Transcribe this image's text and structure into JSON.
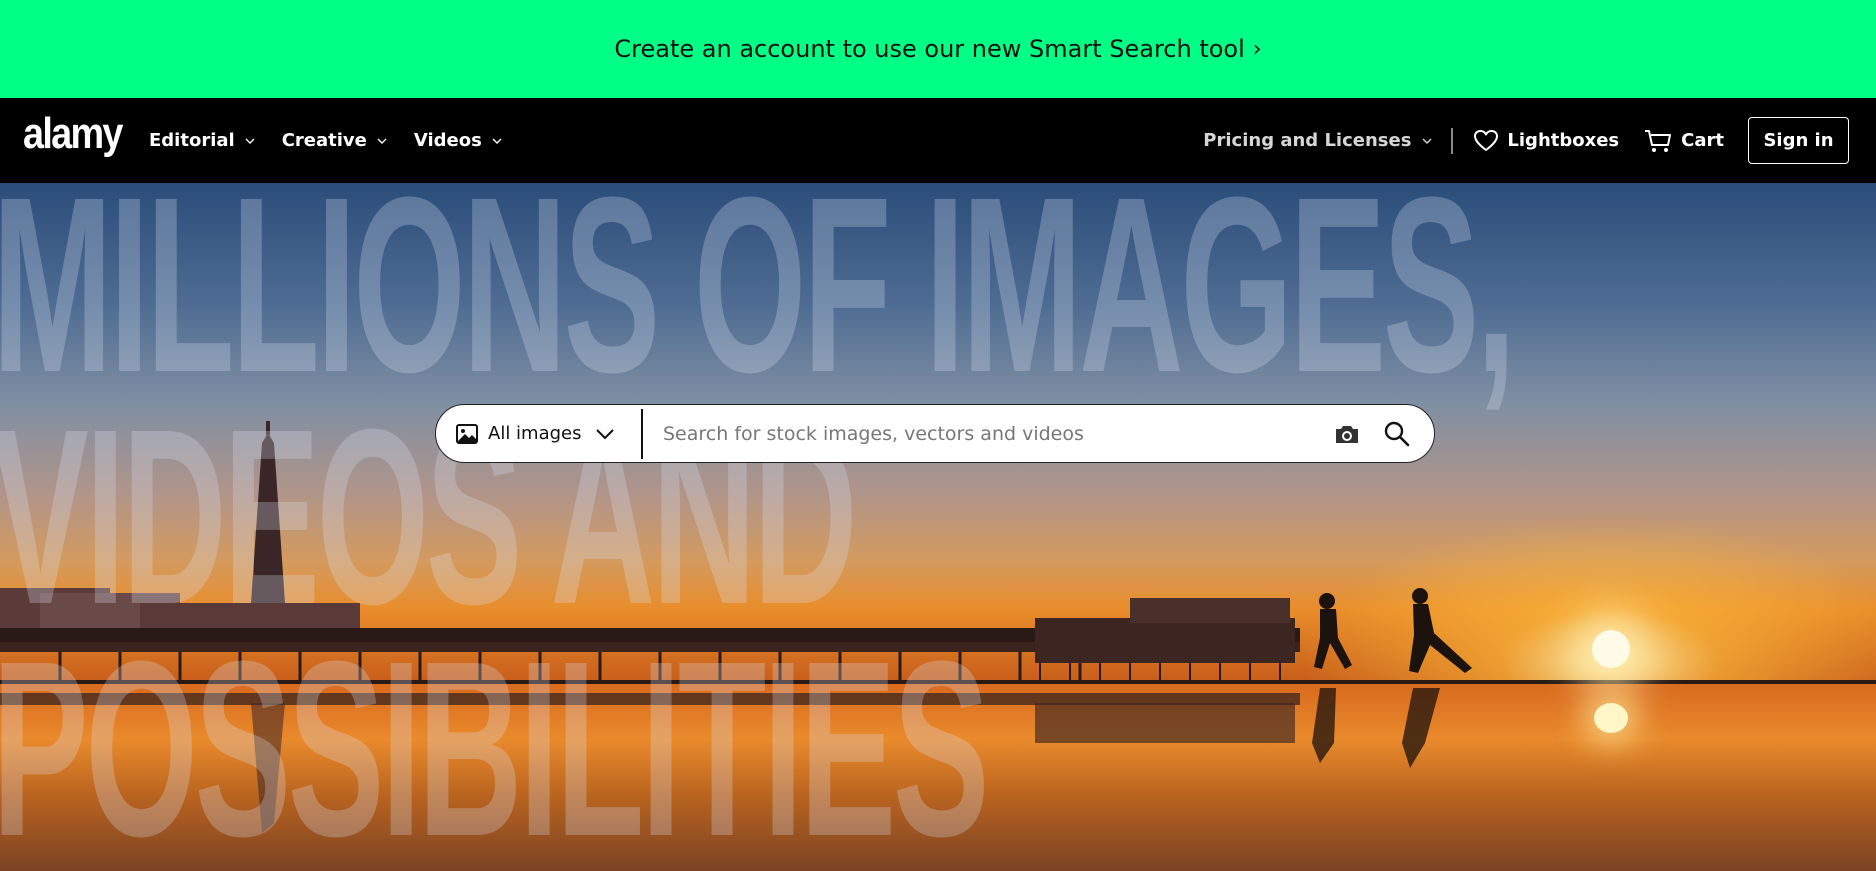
{
  "promo": {
    "text": "Create an account to use our new Smart Search tool",
    "chevron": "›"
  },
  "nav": {
    "logo": "alamy",
    "items": [
      {
        "label": "Editorial"
      },
      {
        "label": "Creative"
      },
      {
        "label": "Videos"
      }
    ],
    "pricing_label": "Pricing and Licenses",
    "lightboxes_label": "Lightboxes",
    "cart_label": "Cart",
    "signin_label": "Sign in"
  },
  "hero": {
    "headline_lines": [
      "MILLIONS OF IMAGES,",
      "VIDEOS AND",
      "POSSIBILITIES"
    ]
  },
  "search": {
    "type_label": "All images",
    "placeholder": "Search for stock images, vectors and videos",
    "value": ""
  },
  "icons": {
    "promo": "chevron-right-icon",
    "nav_caret": "chevron-down-icon",
    "lightbox": "heart-icon",
    "cart": "cart-icon",
    "type": "image-icon",
    "camera": "camera-icon",
    "search": "search-icon"
  },
  "colors": {
    "promo_bg": "#00ff85",
    "nav_bg": "#000000"
  }
}
